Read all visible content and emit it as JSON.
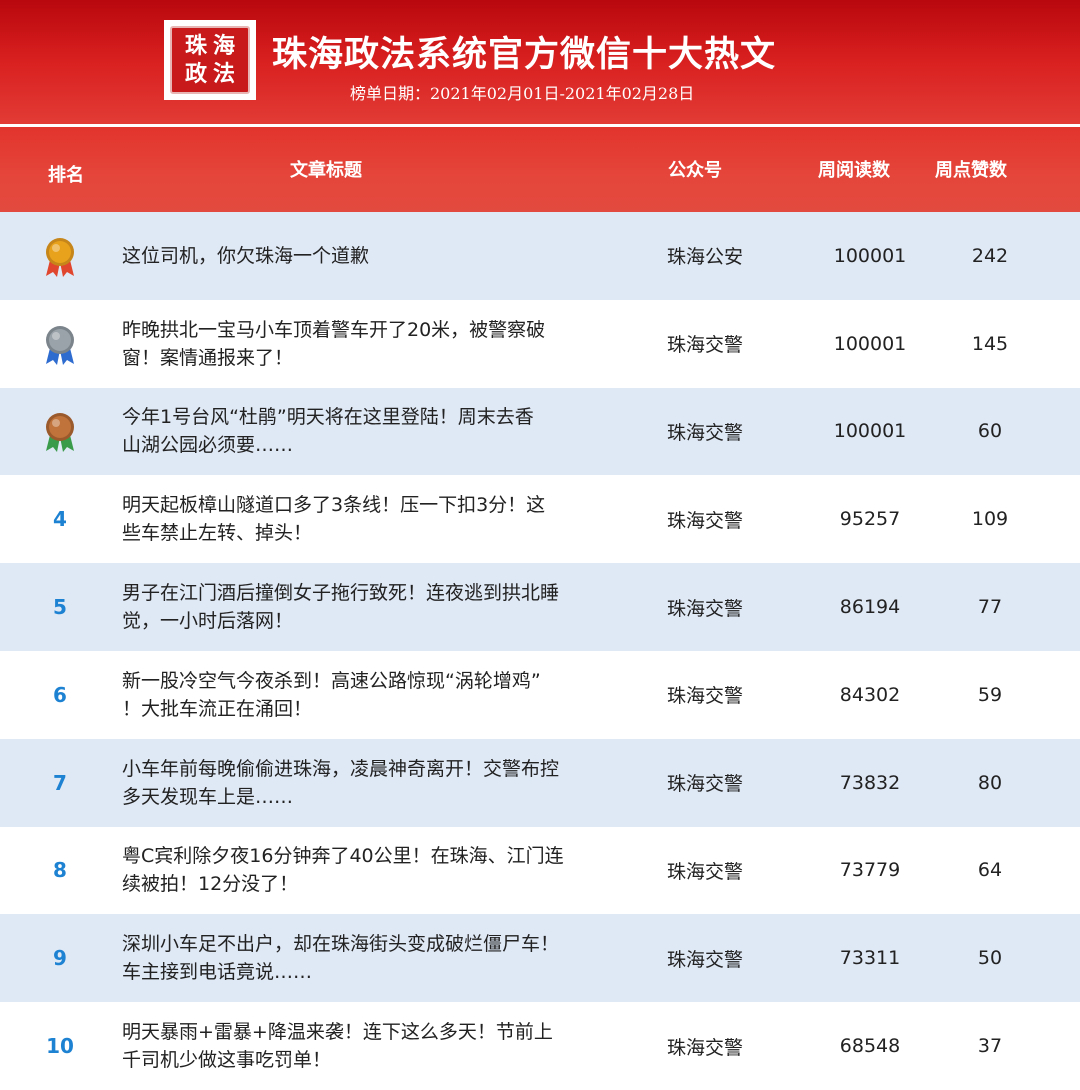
{
  "header": {
    "seal_chars": [
      "珠",
      "海",
      "政",
      "法"
    ],
    "title": "珠海政法系统官方微信十大热文",
    "date_range": "榜单日期：2021年02月01日-2021年02月28日"
  },
  "columns": {
    "rank": "排名",
    "title": "文章标题",
    "account": "公众号",
    "weekly_reads": "周阅读数",
    "weekly_likes": "周点赞数"
  },
  "colors": {
    "brand_red": "#d81e1e",
    "rank_blue": "#1e82d2",
    "row_alt": "#dfe8f5",
    "gold": "#e8a21c",
    "silver": "#9aa2aa",
    "bronze": "#c0733a"
  },
  "rows": [
    {
      "rank": "1",
      "medal": "gold-medal-icon",
      "title": "这位司机，你欠珠海一个道歉",
      "account": "珠海公安",
      "reads": "100001",
      "likes": "242"
    },
    {
      "rank": "2",
      "medal": "silver-medal-icon",
      "title": "昨晚拱北一宝马小车顶着警车开了20米，被警察破窗！案情通报来了！",
      "account": "珠海交警",
      "reads": "100001",
      "likes": "145"
    },
    {
      "rank": "3",
      "medal": "bronze-medal-icon",
      "title": "今年1号台风“杜鹃”明天将在这里登陆！周末去香山湖公园必须要……",
      "account": "珠海交警",
      "reads": "100001",
      "likes": "60"
    },
    {
      "rank": "4",
      "medal": "",
      "title": "明天起板樟山隧道口多了3条线！压一下扣3分！这些车禁止左转、掉头！",
      "account": "珠海交警",
      "reads": "95257",
      "likes": "109"
    },
    {
      "rank": "5",
      "medal": "",
      "title": "男子在江门酒后撞倒女子拖行致死！连夜逃到拱北睡觉，一小时后落网！",
      "account": "珠海交警",
      "reads": "86194",
      "likes": "77"
    },
    {
      "rank": "6",
      "medal": "",
      "title": "新一股冷空气今夜杀到！高速公路惊现“涡轮增鸡”！大批车流正在涌回！",
      "account": "珠海交警",
      "reads": "84302",
      "likes": "59"
    },
    {
      "rank": "7",
      "medal": "",
      "title": "小车年前每晚偷偷进珠海，凌晨神奇离开！交警布控多天发现车上是……",
      "account": "珠海交警",
      "reads": "73832",
      "likes": "80"
    },
    {
      "rank": "8",
      "medal": "",
      "title": "粤C宾利除夕夜16分钟奔了40公里！在珠海、江门连续被拍！12分没了！",
      "account": "珠海交警",
      "reads": "73779",
      "likes": "64"
    },
    {
      "rank": "9",
      "medal": "",
      "title": "深圳小车足不出户，却在珠海街头变成破烂僵尸车！车主接到电话竟说……",
      "account": "珠海交警",
      "reads": "73311",
      "likes": "50"
    },
    {
      "rank": "10",
      "medal": "",
      "title": "明天暴雨+雷暴+降温来袭！连下这么多天！节前上千司机少做这事吃罚单！",
      "account": "珠海交警",
      "reads": "68548",
      "likes": "37"
    }
  ],
  "title_lines": [
    [
      "这位司机，你欠珠海一个道歉"
    ],
    [
      "昨晚拱北一宝马小车顶着警车开了20米，被警察破",
      "窗！案情通报来了！"
    ],
    [
      "今年1号台风“杜鹃”明天将在这里登陆！周末去香",
      "山湖公园必须要……"
    ],
    [
      "明天起板樟山隧道口多了3条线！压一下扣3分！这",
      "些车禁止左转、掉头！"
    ],
    [
      "男子在江门酒后撞倒女子拖行致死！连夜逃到拱北睡",
      "觉，一小时后落网！"
    ],
    [
      "新一股冷空气今夜杀到！高速公路惊现“涡轮增鸡”",
      "！大批车流正在涌回！"
    ],
    [
      "小车年前每晚偷偷进珠海，凌晨神奇离开！交警布控",
      "多天发现车上是……"
    ],
    [
      "粤C宾利除夕夜16分钟奔了40公里！在珠海、江门连",
      "续被拍！12分没了！"
    ],
    [
      "深圳小车足不出户，却在珠海街头变成破烂僵尸车！",
      "车主接到电话竟说……"
    ],
    [
      "明天暴雨+雷暴+降温来袭！连下这么多天！节前上",
      "千司机少做这事吃罚单！"
    ]
  ]
}
